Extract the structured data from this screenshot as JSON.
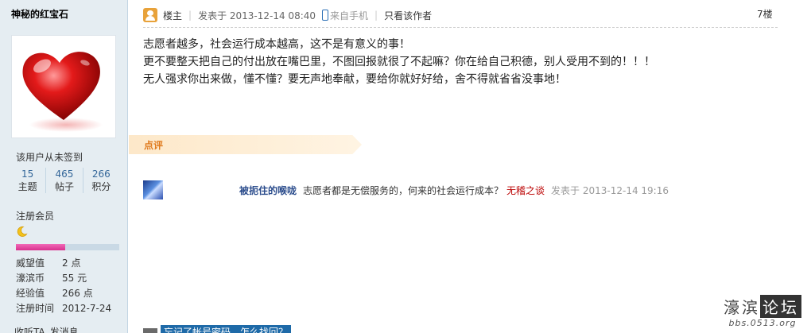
{
  "user": {
    "name": "神秘的红宝石",
    "signin_status": "该用户从未签到",
    "stats": [
      {
        "value": "15",
        "label": "主题"
      },
      {
        "value": "465",
        "label": "帖子"
      },
      {
        "value": "266",
        "label": "积分"
      }
    ],
    "group": "注册会员",
    "group_icon": "moon-icon",
    "level_progress": 0.48,
    "info": [
      {
        "label": "威望值",
        "value": "2 点"
      },
      {
        "label": "濠滨币",
        "value": "55 元"
      },
      {
        "label": "经验值",
        "value": "266 点"
      },
      {
        "label": "注册时间",
        "value": "2012-7-24"
      }
    ],
    "actions": [
      "收听TA",
      "发消息"
    ]
  },
  "post": {
    "owner_label": "楼主",
    "posted_time": "发表于 2013-12-14 08:40",
    "source": "来自手机",
    "only_author": "只看该作者",
    "floor": "7楼",
    "lines": [
      "志愿者越多，社会运行成本越高，这不是有意义的事！",
      "更不要整天把自己的付出放在嘴巴里，不图回报就很了不起嘛？你在给自己积德，别人受用不到的！！！",
      "无人强求你出来做，懂不懂？要无声地奉献，要给你就好好给，舍不得就省省没事地！"
    ]
  },
  "dianping": {
    "label": "点评"
  },
  "comment": {
    "user": "被扼住的喉咙",
    "text": "志愿者都是无偿服务的，何来的社会运行成本？",
    "highlight": "无稽之谈",
    "time": "发表于 2013-12-14 19:16"
  },
  "tip": {
    "text": "忘记了帐号密码，怎么找回？"
  },
  "watermark": {
    "name_a": "濠滨",
    "name_b": "论坛",
    "domain": "bbs.0513.org"
  },
  "colors": {
    "sidebar_bg": "#e5edf2",
    "link_blue": "#369",
    "highlight_red": "#b00",
    "dianping_orange": "#e07b1e",
    "level_pink": "#d9308e"
  }
}
